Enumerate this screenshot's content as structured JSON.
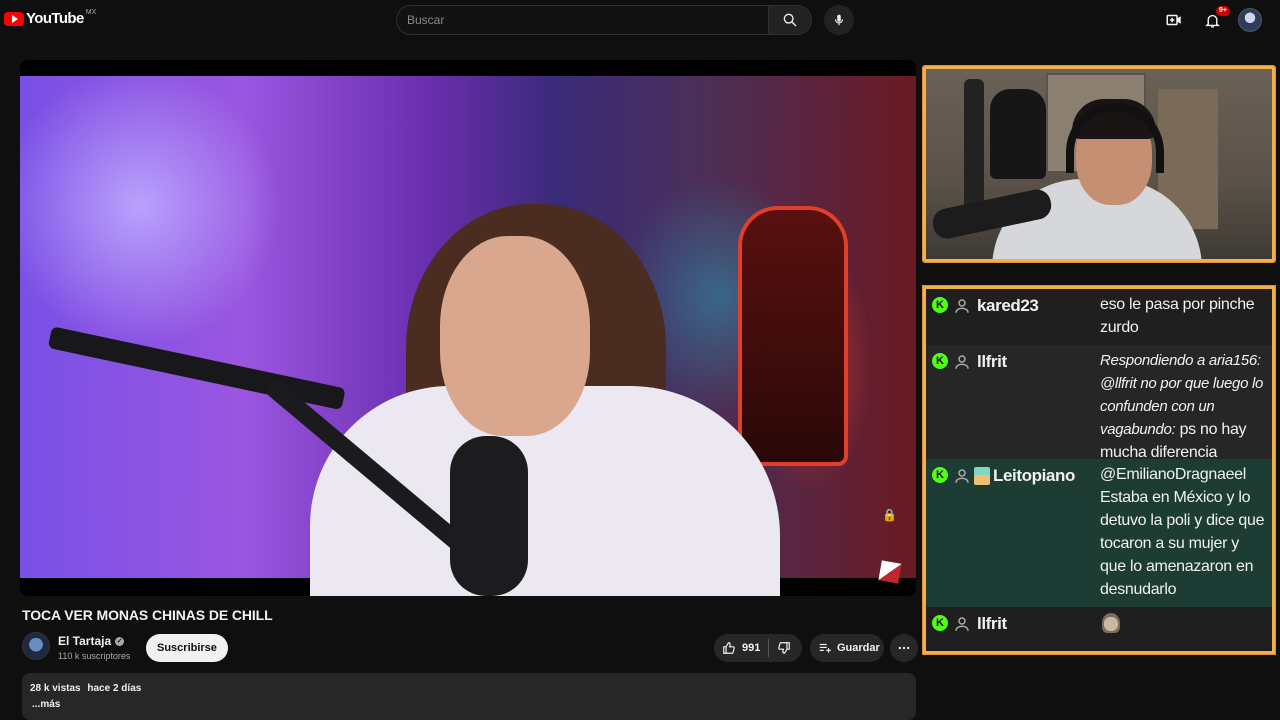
{
  "header": {
    "logo_text": "YouTube",
    "country_code": "MX",
    "search_placeholder": "Buscar",
    "notifications_count": "9+"
  },
  "video": {
    "title": "TOCA VER MONAS CHINAS DE CHILL",
    "channel_name": "El Tartaja",
    "subscribers": "110 k suscriptores",
    "subscribe_label": "Suscribirse",
    "like_count": "991",
    "save_label": "Guardar"
  },
  "description": {
    "views": "28 k vistas",
    "date": "hace 2 días",
    "more_label": "...más"
  },
  "chat": {
    "messages": [
      {
        "user": "kared23",
        "text": "eso le pasa por pinche zurdo"
      },
      {
        "user": "llfrit",
        "reply_prefix": "Respondiendo a aria156: @llfrit no por que luego lo confunden con un vagabundo:",
        "text": "ps no hay mucha diferencia"
      },
      {
        "user": "Leitopiano",
        "text": "@EmilianoDragnaeel Estaba en México y lo detuvo la poli y dice que tocaron a su mujer y que lo amenazaron en desnudarlo"
      },
      {
        "user": "llfrit",
        "text": ""
      }
    ]
  },
  "colors": {
    "accent_border": "#f2b04b",
    "kick_green": "#53fc18",
    "youtube_red": "#ff0000"
  }
}
